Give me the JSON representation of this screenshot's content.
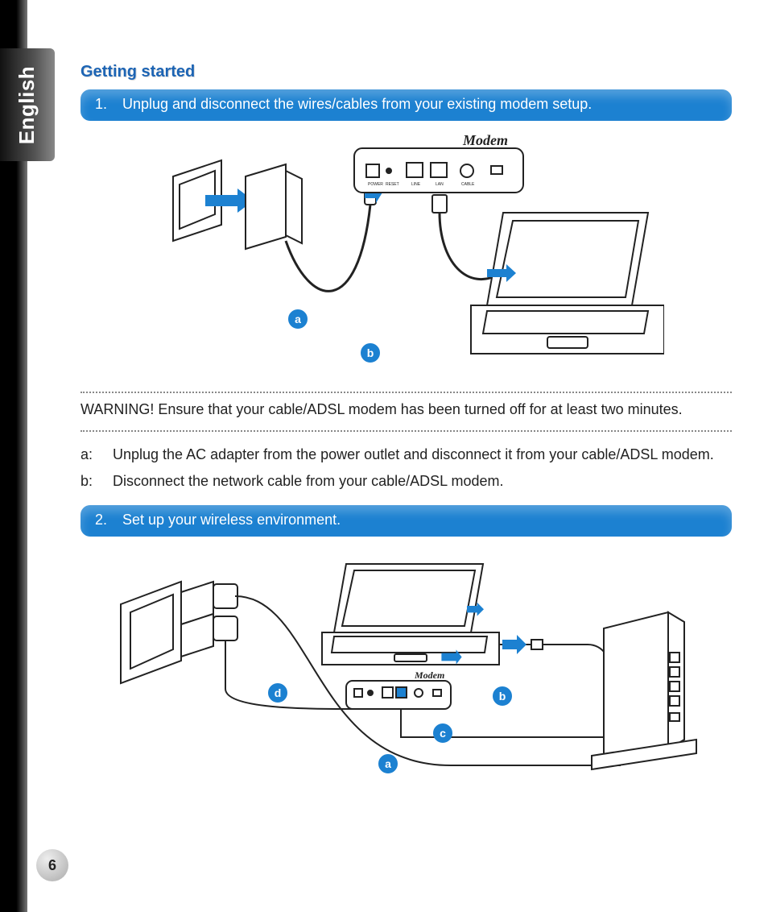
{
  "language_tab": "English",
  "page_number": "6",
  "section_title": "Getting started",
  "step1": {
    "number": "1.",
    "text": "Unplug and disconnect the wires/cables from your existing modem setup.",
    "labels": {
      "a": "a",
      "b": "b"
    },
    "modem_label": "Modem",
    "port_labels": {
      "power": "POWER",
      "reset": "RESET",
      "line": "LINE",
      "lan": "LAN",
      "cable": "CABLE"
    }
  },
  "warning": "WARNING!  Ensure that your cable/ADSL modem has been turned off for at least two minutes.",
  "explain": {
    "a_key": "a:",
    "a_text": "Unplug the AC adapter from the power outlet and disconnect it from your cable/ADSL modem.",
    "b_key": "b:",
    "b_text": "Disconnect the network cable from your cable/ADSL modem."
  },
  "step2": {
    "number": "2.",
    "text": "Set up your wireless environment.",
    "labels": {
      "a": "a",
      "b": "b",
      "c": "c",
      "d": "d"
    },
    "modem_label": "Modem"
  }
}
